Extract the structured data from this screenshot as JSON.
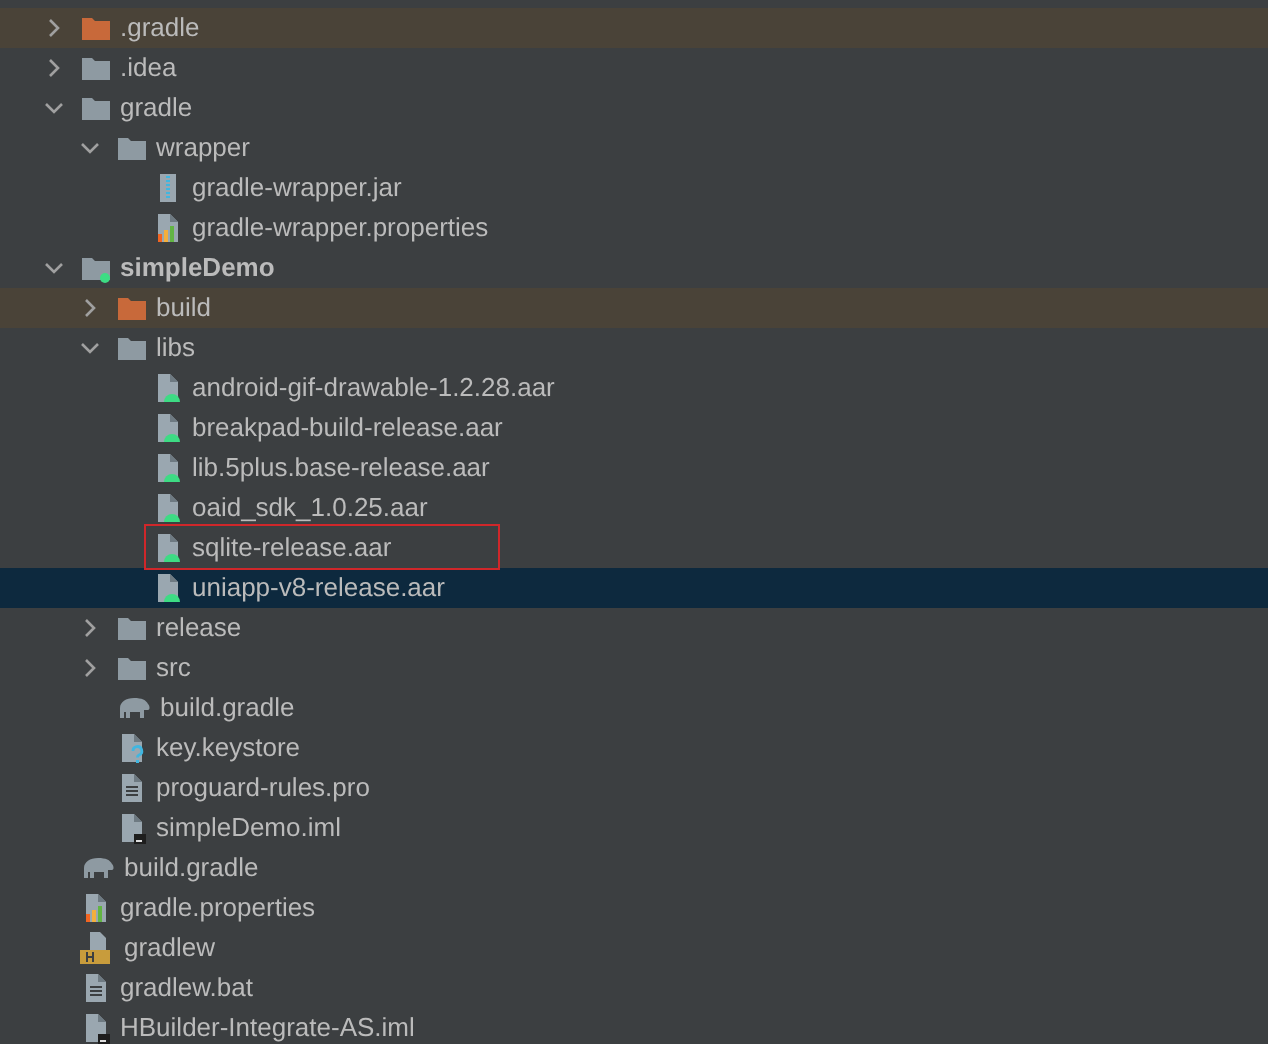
{
  "tree": [
    {
      "label": ".gradle",
      "kind": "folder",
      "excluded": true,
      "expanded": false,
      "selected": false
    },
    {
      "label": ".idea",
      "kind": "folder",
      "excluded": false,
      "expanded": false,
      "selected": false
    },
    {
      "label": "gradle",
      "kind": "folder",
      "excluded": false,
      "expanded": true,
      "selected": false,
      "children": [
        {
          "label": "wrapper",
          "kind": "folder",
          "excluded": false,
          "expanded": true,
          "selected": false,
          "children": [
            {
              "label": "gradle-wrapper.jar",
              "kind": "jar",
              "selected": false
            },
            {
              "label": "gradle-wrapper.properties",
              "kind": "properties",
              "selected": false
            }
          ]
        }
      ]
    },
    {
      "label": "simpleDemo",
      "kind": "module",
      "excluded": false,
      "expanded": true,
      "selected": false,
      "children": [
        {
          "label": "build",
          "kind": "folder",
          "excluded": true,
          "expanded": false,
          "selected": false
        },
        {
          "label": "libs",
          "kind": "folder",
          "excluded": false,
          "expanded": true,
          "selected": false,
          "children": [
            {
              "label": "android-gif-drawable-1.2.28.aar",
              "kind": "aar",
              "selected": false
            },
            {
              "label": "breakpad-build-release.aar",
              "kind": "aar",
              "selected": false
            },
            {
              "label": "lib.5plus.base-release.aar",
              "kind": "aar",
              "selected": false
            },
            {
              "label": "oaid_sdk_1.0.25.aar",
              "kind": "aar",
              "selected": false
            },
            {
              "label": "sqlite-release.aar",
              "kind": "aar",
              "selected": false,
              "highlighted": true
            },
            {
              "label": "uniapp-v8-release.aar",
              "kind": "aar",
              "selected": true
            }
          ]
        },
        {
          "label": "release",
          "kind": "folder",
          "excluded": false,
          "expanded": false,
          "selected": false
        },
        {
          "label": "src",
          "kind": "folder",
          "excluded": false,
          "expanded": false,
          "selected": false
        },
        {
          "label": "build.gradle",
          "kind": "gradle",
          "selected": false
        },
        {
          "label": "key.keystore",
          "kind": "unknown",
          "selected": false
        },
        {
          "label": "proguard-rules.pro",
          "kind": "text",
          "selected": false
        },
        {
          "label": "simpleDemo.iml",
          "kind": "iml",
          "selected": false
        }
      ]
    },
    {
      "label": "build.gradle",
      "kind": "gradle",
      "selected": false
    },
    {
      "label": "gradle.properties",
      "kind": "properties",
      "selected": false
    },
    {
      "label": "gradlew",
      "kind": "shell",
      "selected": false
    },
    {
      "label": "gradlew.bat",
      "kind": "text",
      "selected": false
    },
    {
      "label": "HBuilder-Integrate-AS.iml",
      "kind": "iml",
      "selected": false
    }
  ]
}
